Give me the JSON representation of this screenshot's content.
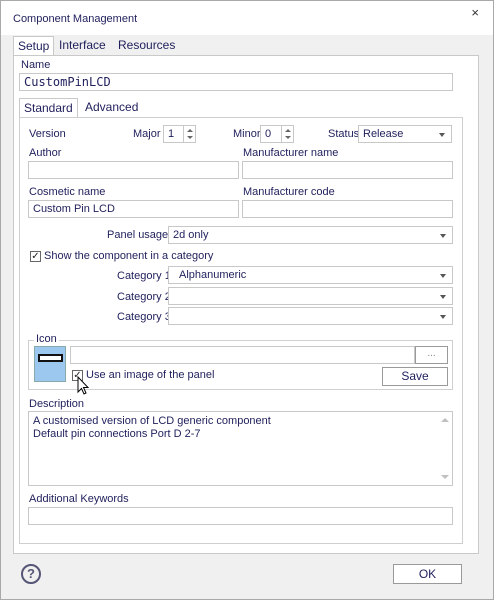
{
  "window": {
    "title": "Component Management",
    "close_glyph": "×"
  },
  "tabs_top": [
    {
      "label": "Setup"
    },
    {
      "label": "Interface"
    },
    {
      "label": "Resources"
    }
  ],
  "name": {
    "label": "Name",
    "value": "CustomPinLCD"
  },
  "tabs_inner": [
    {
      "label": "Standard"
    },
    {
      "label": "Advanced"
    }
  ],
  "version": {
    "label": "Version",
    "major_label": "Major",
    "major_value": "1",
    "minor_label": "Minor",
    "minor_value": "0",
    "status_label": "Status",
    "status_value": "Release"
  },
  "author": {
    "label": "Author",
    "value": ""
  },
  "manufacturer_name": {
    "label": "Manufacturer name",
    "value": ""
  },
  "cosmetic_name": {
    "label": "Cosmetic name",
    "value": "Custom Pin LCD"
  },
  "manufacturer_code": {
    "label": "Manufacturer code",
    "value": ""
  },
  "panel_usage": {
    "label": "Panel usage:",
    "value": "2d only"
  },
  "show_in_category": {
    "label": "Show the component in a category",
    "checked": true
  },
  "categories": [
    {
      "label": "Category 1",
      "value": "Alphanumeric"
    },
    {
      "label": "Category 2",
      "value": ""
    },
    {
      "label": "Category 3",
      "value": ""
    }
  ],
  "icon": {
    "label": "Icon",
    "path_value": "",
    "browse_label": "...",
    "use_panel_image_label": "Use an image of the panel",
    "use_panel_image_checked": true,
    "save_label": "Save"
  },
  "description": {
    "label": "Description",
    "line1": "A customised version of LCD generic  component",
    "line2": "Default pin connections Port D 2-7"
  },
  "keywords": {
    "label": "Additional Keywords",
    "value": ""
  },
  "footer": {
    "help_glyph": "?",
    "ok_label": "OK"
  },
  "colors": {
    "text": "#1f1f5c",
    "icon_fill": "#9cc7ee",
    "border": "#c8c8c8"
  }
}
